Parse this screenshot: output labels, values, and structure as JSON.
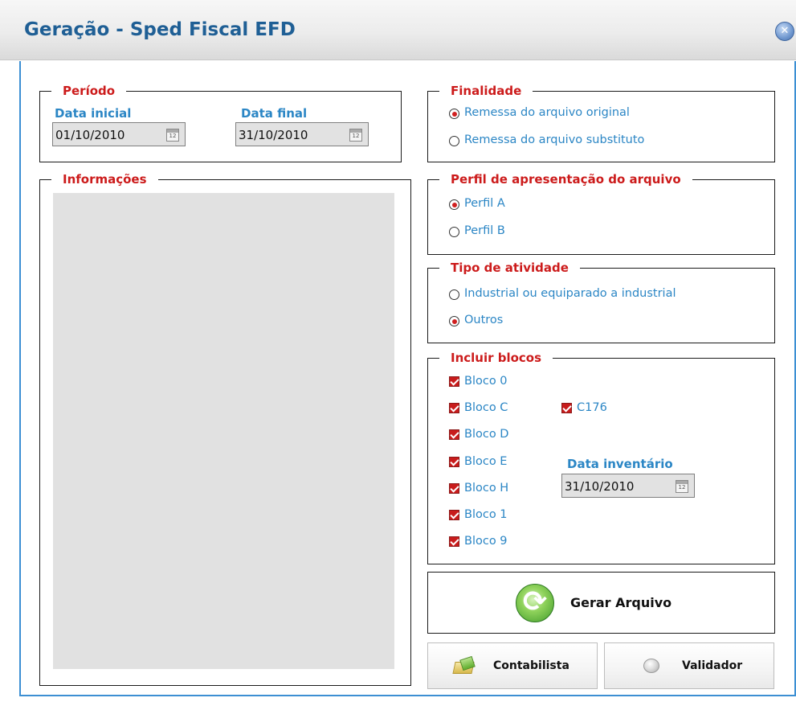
{
  "window": {
    "title": "Geração - Sped Fiscal EFD"
  },
  "periodo": {
    "legend": "Período",
    "data_inicial_label": "Data inicial",
    "data_inicial_value": "01/10/2010",
    "data_final_label": "Data final",
    "data_final_value": "31/10/2010"
  },
  "finalidade": {
    "legend": "Finalidade",
    "options": [
      {
        "label": "Remessa do arquivo original",
        "selected": true
      },
      {
        "label": "Remessa do arquivo substituto",
        "selected": false
      }
    ]
  },
  "informacoes": {
    "legend": "Informações"
  },
  "perfil": {
    "legend": "Perfil de apresentação do arquivo",
    "options": [
      {
        "label": "Perfil A",
        "selected": true
      },
      {
        "label": "Perfil B",
        "selected": false
      }
    ]
  },
  "tipo_atividade": {
    "legend": "Tipo de atividade",
    "options": [
      {
        "label": "Industrial ou equiparado a industrial",
        "selected": false
      },
      {
        "label": "Outros",
        "selected": true
      }
    ]
  },
  "incluir_blocos": {
    "legend": "Incluir blocos",
    "blocos": [
      {
        "label": "Bloco 0",
        "checked": true
      },
      {
        "label": "Bloco C",
        "checked": true
      },
      {
        "label": "Bloco D",
        "checked": true
      },
      {
        "label": "Bloco E",
        "checked": true
      },
      {
        "label": "Bloco H",
        "checked": true
      },
      {
        "label": "Bloco 1",
        "checked": true
      },
      {
        "label": "Bloco 9",
        "checked": true
      }
    ],
    "c176": {
      "label": "C176",
      "checked": true
    },
    "data_inventario_label": "Data inventário",
    "data_inventario_value": "31/10/2010"
  },
  "calendar_icon_text": "12",
  "actions": {
    "gerar_label": "Gerar Arquivo",
    "contabilista_label": "Contabilista",
    "validador_label": "Validador"
  },
  "colors": {
    "title": "#1f5f95",
    "legend": "#cc1b1b",
    "label": "#2b86c5",
    "frame": "#3c8fd3"
  },
  "icons": {
    "close": "close-icon",
    "calendar": "calendar-icon",
    "gerar": "refresh-icon",
    "contabilista": "folder-icon",
    "validador": "validator-icon"
  }
}
